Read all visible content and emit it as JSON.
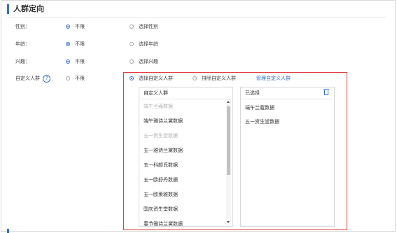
{
  "section": {
    "title": "人群定向"
  },
  "rows": [
    {
      "label": "性别：",
      "option_a": "不限",
      "option_b": "选择性别"
    },
    {
      "label": "年龄：",
      "option_a": "不限",
      "option_b": "选择年龄"
    },
    {
      "label": "兴趣：",
      "option_a": "不限",
      "option_b": "选择兴趣"
    }
  ],
  "custom": {
    "label": "自定义人群",
    "help_icon": "?",
    "option_unlimited": "不限",
    "option_select": "选择自定义人群",
    "option_exclude": "排除自定义人群",
    "manage_link": "管理自定义人群"
  },
  "left_panel": {
    "header": "自定义人群",
    "items": [
      {
        "label": "端午兰蔻数据",
        "disabled": true
      },
      {
        "label": "端午雅诗兰黛数据",
        "disabled": false
      },
      {
        "label": "五一资生堂数据",
        "disabled": true
      },
      {
        "label": "五一雅诗兰黛数据",
        "disabled": false
      },
      {
        "label": "五一科颜氏数据",
        "disabled": false
      },
      {
        "label": "五一欧舒丹数据",
        "disabled": false
      },
      {
        "label": "五一欧莱雅数据",
        "disabled": false
      },
      {
        "label": "国庆资生堂数据",
        "disabled": false
      },
      {
        "label": "春节雅诗兰黛数据",
        "disabled": false
      }
    ]
  },
  "right_panel": {
    "header": "已选择",
    "trash_icon": "trash-icon",
    "items": [
      "端午兰蔻数据",
      "五一资生堂数据"
    ]
  },
  "colors": {
    "accent": "#2f6fd6",
    "highlight": "#e23b3b"
  }
}
